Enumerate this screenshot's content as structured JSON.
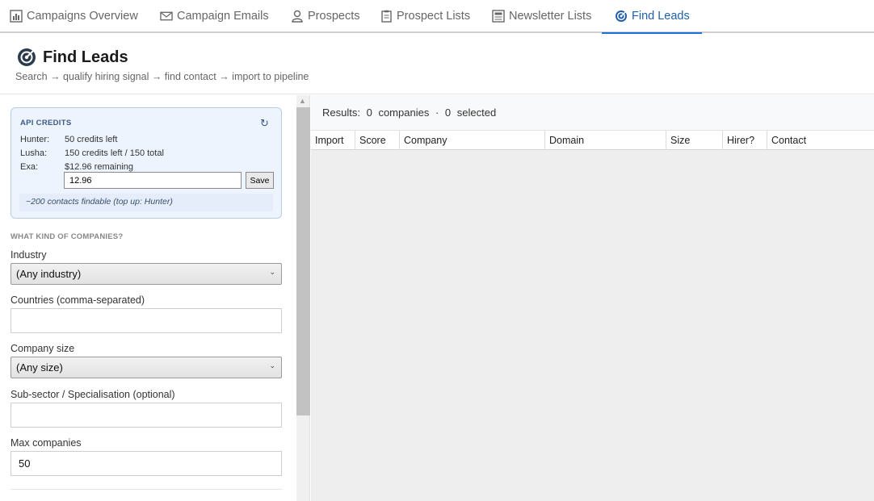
{
  "tabs": [
    {
      "label": "Campaigns Overview",
      "icon": "bar-chart-icon",
      "active": false
    },
    {
      "label": "Campaign Emails",
      "icon": "envelope-icon",
      "active": false
    },
    {
      "label": "Prospects",
      "icon": "person-icon",
      "active": false
    },
    {
      "label": "Prospect Lists",
      "icon": "clipboard-icon",
      "active": false
    },
    {
      "label": "Newsletter Lists",
      "icon": "newspaper-icon",
      "active": false
    },
    {
      "label": "Find Leads",
      "icon": "target-icon",
      "active": true
    }
  ],
  "header": {
    "title": "Find Leads",
    "subtitle": "Search → qualify hiring signal → find contact → import to pipeline"
  },
  "credits": {
    "title": "API CREDITS",
    "refresh_icon": "↻",
    "rows": [
      {
        "label": "Hunter:",
        "value": "50 credits left"
      },
      {
        "label": "Lusha:",
        "value": "150 credits left / 150 total"
      },
      {
        "label": "Exa:",
        "value": "$12.96 remaining"
      }
    ],
    "exa_input_value": "12.96",
    "save_label": "Save",
    "findable_note": "~200 contacts findable  (top up: Hunter)"
  },
  "filters": {
    "section_heading": "WHAT KIND OF COMPANIES?",
    "industry_label": "Industry",
    "industry_value": "(Any industry)",
    "countries_label": "Countries (comma-separated)",
    "countries_value": "",
    "size_label": "Company size",
    "size_value": "(Any size)",
    "subsector_label": "Sub-sector / Specialisation (optional)",
    "subsector_value": "",
    "max_label": "Max companies",
    "max_value": "50"
  },
  "results": {
    "prefix": "Results:",
    "companies_count": "0",
    "companies_label": "companies",
    "separator": "·",
    "selected_count": "0",
    "selected_label": "selected",
    "columns": [
      "Import",
      "Score",
      "Company",
      "Domain",
      "Size",
      "Hirer?",
      "Contact"
    ]
  },
  "colors": {
    "accent": "#1f6fd1",
    "credits_bg": "#eef4fd"
  }
}
